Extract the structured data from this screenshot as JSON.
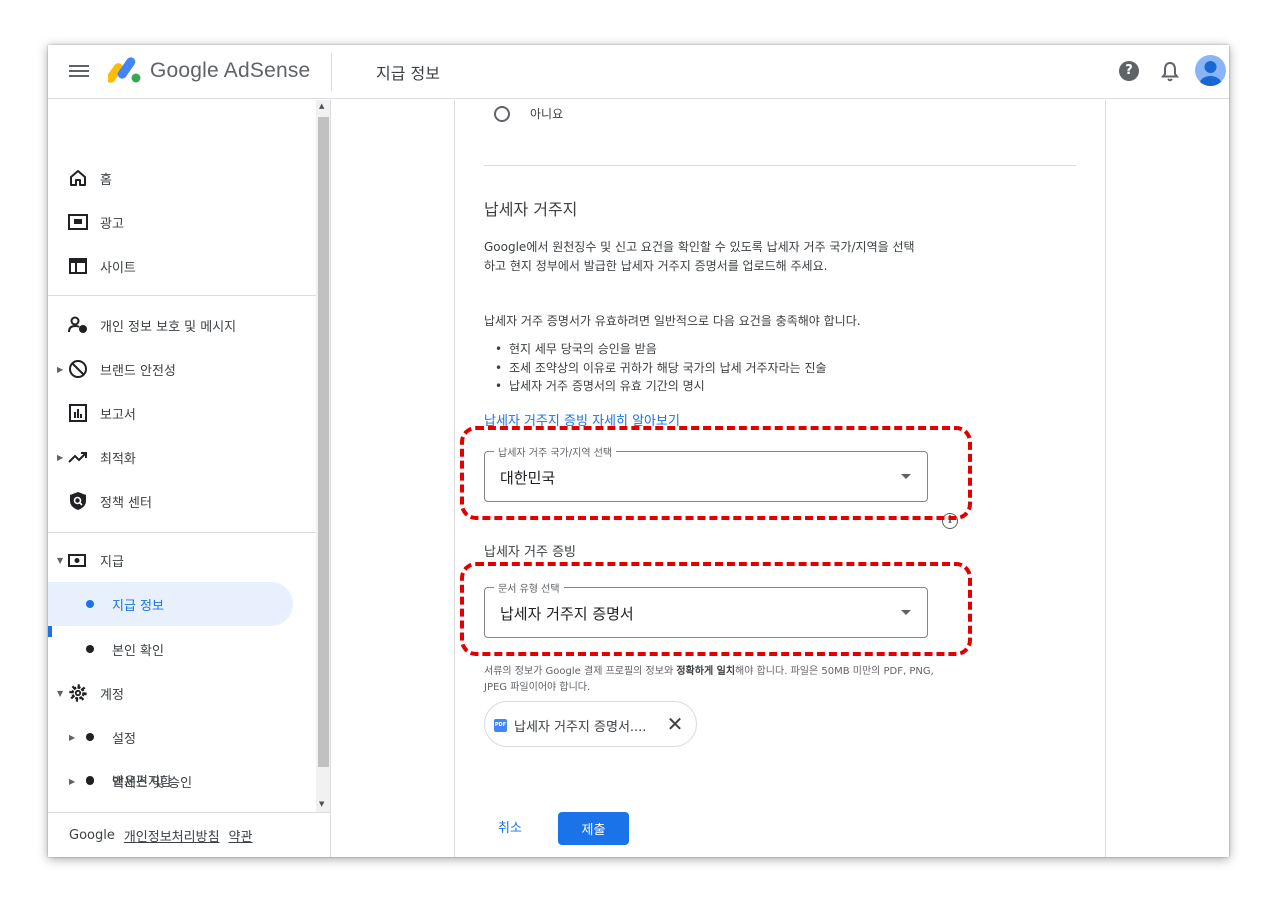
{
  "header": {
    "brand": "Google AdSense",
    "page_title": "지급 정보",
    "help_icon": "?"
  },
  "sidebar": {
    "items": [
      {
        "label": "홈",
        "icon": "home-icon"
      },
      {
        "label": "광고",
        "icon": "ads-icon"
      },
      {
        "label": "사이트",
        "icon": "sites-icon"
      },
      {
        "label": "개인 정보 보호 및 메시지",
        "icon": "privacy-icon"
      },
      {
        "label": "브랜드 안전성",
        "icon": "block-icon"
      },
      {
        "label": "보고서",
        "icon": "report-icon"
      },
      {
        "label": "최적화",
        "icon": "trending-icon"
      },
      {
        "label": "정책 센터",
        "icon": "policy-icon"
      },
      {
        "label": "지급",
        "icon": "payments-icon"
      },
      {
        "label": "지급 정보"
      },
      {
        "label": "본인 확인"
      },
      {
        "label": "계정",
        "icon": "gear-icon"
      },
      {
        "label": "설정"
      },
      {
        "label": "액세스 및 승인"
      },
      {
        "label": "받은편지함"
      }
    ],
    "footer": {
      "google": "Google",
      "privacy": "개인정보처리방침",
      "terms": "약관"
    }
  },
  "main": {
    "radio_no_label": "아니요",
    "section_title": "납세자 거주지",
    "intro": "Google에서 원천징수 및 신고 요건을 확인할 수 있도록 납세자 거주 국가/지역을 선택하고 현지 정부에서 발급한 납세자 거주지 증명서를 업로드해 주세요.",
    "requirement_intro": "납세자 거주 증명서가 유효하려면 일반적으로 다음 요건을 충족해야 합니다.",
    "requirements": [
      "현지 세무 당국의 승인을 받음",
      "조세 조약상의 이유로 귀하가 해당 국가의 납세 거주자라는 진술",
      "납세자 거주 증명서의 유효 기간의 명시"
    ],
    "learn_more": "납세자 거주지 증빙 자세히 알아보기",
    "country_select": {
      "legend": "납세자 거주 국가/지역 선택",
      "value": "대한민국"
    },
    "proof_title": "납세자 거주 증빙",
    "doc_select": {
      "legend": "문서 유형 선택",
      "value": "납세자 거주지 증명서"
    },
    "hint_pre": "서류의 정보가 Google 결제 프로필의 정보와 ",
    "hint_bold": "정확하게 일치",
    "hint_post": "해야 합니다. 파일은 50MB 미만의 PDF, PNG, JPEG 파일이어야 합니다.",
    "file_chip": {
      "badge": "PDF",
      "name": "납세자 거주지 증명서....",
      "close": "✕"
    },
    "cancel_label": "취소",
    "submit_label": "제출"
  },
  "colors": {
    "accent": "#1a73e8",
    "highlight": "#e00000",
    "active_bg": "#e8f0fe"
  }
}
